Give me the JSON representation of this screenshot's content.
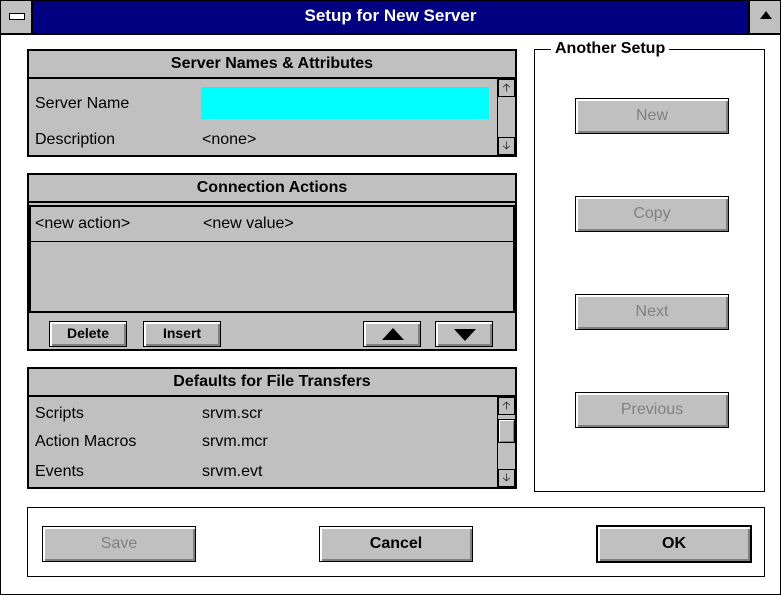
{
  "window": {
    "title": "Setup for New Server"
  },
  "server_names": {
    "heading": "Server Names & Attributes",
    "server_name_label": "Server Name",
    "server_name_value": "",
    "description_label": "Description",
    "description_value": "<none>"
  },
  "connection_actions": {
    "heading": "Connection Actions",
    "rows": [
      {
        "action": "<new action>",
        "value": "<new value>"
      }
    ],
    "delete_label": "Delete",
    "insert_label": "Insert"
  },
  "file_transfers": {
    "heading": "Defaults for File Transfers",
    "rows": [
      {
        "label": "Scripts",
        "value": "srvm.scr"
      },
      {
        "label": "Action Macros",
        "value": "srvm.mcr"
      },
      {
        "label": "Events",
        "value": "srvm.evt"
      }
    ]
  },
  "another_setup": {
    "legend": "Another Setup",
    "new_label": "New",
    "copy_label": "Copy",
    "next_label": "Next",
    "previous_label": "Previous"
  },
  "footer": {
    "save_label": "Save",
    "cancel_label": "Cancel",
    "ok_label": "OK"
  },
  "colors": {
    "title_bar": "#000080",
    "panel": "#c0c0c0",
    "highlight_field": "#00ffff"
  }
}
